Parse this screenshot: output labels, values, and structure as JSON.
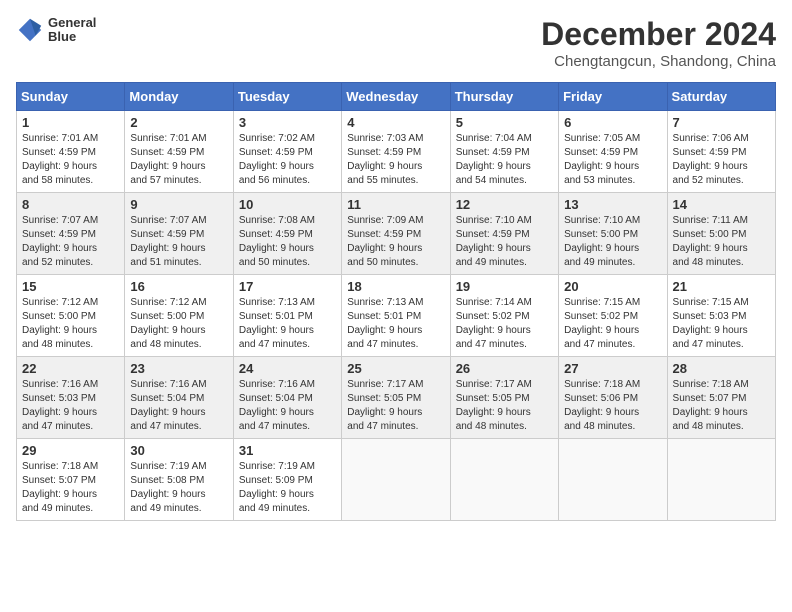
{
  "header": {
    "logo_line1": "General",
    "logo_line2": "Blue",
    "month": "December 2024",
    "location": "Chengtangcun, Shandong, China"
  },
  "weekdays": [
    "Sunday",
    "Monday",
    "Tuesday",
    "Wednesday",
    "Thursday",
    "Friday",
    "Saturday"
  ],
  "weeks": [
    [
      {
        "day": "1",
        "info": "Sunrise: 7:01 AM\nSunset: 4:59 PM\nDaylight: 9 hours\nand 58 minutes."
      },
      {
        "day": "2",
        "info": "Sunrise: 7:01 AM\nSunset: 4:59 PM\nDaylight: 9 hours\nand 57 minutes."
      },
      {
        "day": "3",
        "info": "Sunrise: 7:02 AM\nSunset: 4:59 PM\nDaylight: 9 hours\nand 56 minutes."
      },
      {
        "day": "4",
        "info": "Sunrise: 7:03 AM\nSunset: 4:59 PM\nDaylight: 9 hours\nand 55 minutes."
      },
      {
        "day": "5",
        "info": "Sunrise: 7:04 AM\nSunset: 4:59 PM\nDaylight: 9 hours\nand 54 minutes."
      },
      {
        "day": "6",
        "info": "Sunrise: 7:05 AM\nSunset: 4:59 PM\nDaylight: 9 hours\nand 53 minutes."
      },
      {
        "day": "7",
        "info": "Sunrise: 7:06 AM\nSunset: 4:59 PM\nDaylight: 9 hours\nand 52 minutes."
      }
    ],
    [
      {
        "day": "8",
        "info": "Sunrise: 7:07 AM\nSunset: 4:59 PM\nDaylight: 9 hours\nand 52 minutes."
      },
      {
        "day": "9",
        "info": "Sunrise: 7:07 AM\nSunset: 4:59 PM\nDaylight: 9 hours\nand 51 minutes."
      },
      {
        "day": "10",
        "info": "Sunrise: 7:08 AM\nSunset: 4:59 PM\nDaylight: 9 hours\nand 50 minutes."
      },
      {
        "day": "11",
        "info": "Sunrise: 7:09 AM\nSunset: 4:59 PM\nDaylight: 9 hours\nand 50 minutes."
      },
      {
        "day": "12",
        "info": "Sunrise: 7:10 AM\nSunset: 4:59 PM\nDaylight: 9 hours\nand 49 minutes."
      },
      {
        "day": "13",
        "info": "Sunrise: 7:10 AM\nSunset: 5:00 PM\nDaylight: 9 hours\nand 49 minutes."
      },
      {
        "day": "14",
        "info": "Sunrise: 7:11 AM\nSunset: 5:00 PM\nDaylight: 9 hours\nand 48 minutes."
      }
    ],
    [
      {
        "day": "15",
        "info": "Sunrise: 7:12 AM\nSunset: 5:00 PM\nDaylight: 9 hours\nand 48 minutes."
      },
      {
        "day": "16",
        "info": "Sunrise: 7:12 AM\nSunset: 5:00 PM\nDaylight: 9 hours\nand 48 minutes."
      },
      {
        "day": "17",
        "info": "Sunrise: 7:13 AM\nSunset: 5:01 PM\nDaylight: 9 hours\nand 47 minutes."
      },
      {
        "day": "18",
        "info": "Sunrise: 7:13 AM\nSunset: 5:01 PM\nDaylight: 9 hours\nand 47 minutes."
      },
      {
        "day": "19",
        "info": "Sunrise: 7:14 AM\nSunset: 5:02 PM\nDaylight: 9 hours\nand 47 minutes."
      },
      {
        "day": "20",
        "info": "Sunrise: 7:15 AM\nSunset: 5:02 PM\nDaylight: 9 hours\nand 47 minutes."
      },
      {
        "day": "21",
        "info": "Sunrise: 7:15 AM\nSunset: 5:03 PM\nDaylight: 9 hours\nand 47 minutes."
      }
    ],
    [
      {
        "day": "22",
        "info": "Sunrise: 7:16 AM\nSunset: 5:03 PM\nDaylight: 9 hours\nand 47 minutes."
      },
      {
        "day": "23",
        "info": "Sunrise: 7:16 AM\nSunset: 5:04 PM\nDaylight: 9 hours\nand 47 minutes."
      },
      {
        "day": "24",
        "info": "Sunrise: 7:16 AM\nSunset: 5:04 PM\nDaylight: 9 hours\nand 47 minutes."
      },
      {
        "day": "25",
        "info": "Sunrise: 7:17 AM\nSunset: 5:05 PM\nDaylight: 9 hours\nand 47 minutes."
      },
      {
        "day": "26",
        "info": "Sunrise: 7:17 AM\nSunset: 5:05 PM\nDaylight: 9 hours\nand 48 minutes."
      },
      {
        "day": "27",
        "info": "Sunrise: 7:18 AM\nSunset: 5:06 PM\nDaylight: 9 hours\nand 48 minutes."
      },
      {
        "day": "28",
        "info": "Sunrise: 7:18 AM\nSunset: 5:07 PM\nDaylight: 9 hours\nand 48 minutes."
      }
    ],
    [
      {
        "day": "29",
        "info": "Sunrise: 7:18 AM\nSunset: 5:07 PM\nDaylight: 9 hours\nand 49 minutes."
      },
      {
        "day": "30",
        "info": "Sunrise: 7:19 AM\nSunset: 5:08 PM\nDaylight: 9 hours\nand 49 minutes."
      },
      {
        "day": "31",
        "info": "Sunrise: 7:19 AM\nSunset: 5:09 PM\nDaylight: 9 hours\nand 49 minutes."
      },
      {
        "day": "",
        "info": ""
      },
      {
        "day": "",
        "info": ""
      },
      {
        "day": "",
        "info": ""
      },
      {
        "day": "",
        "info": ""
      }
    ]
  ]
}
